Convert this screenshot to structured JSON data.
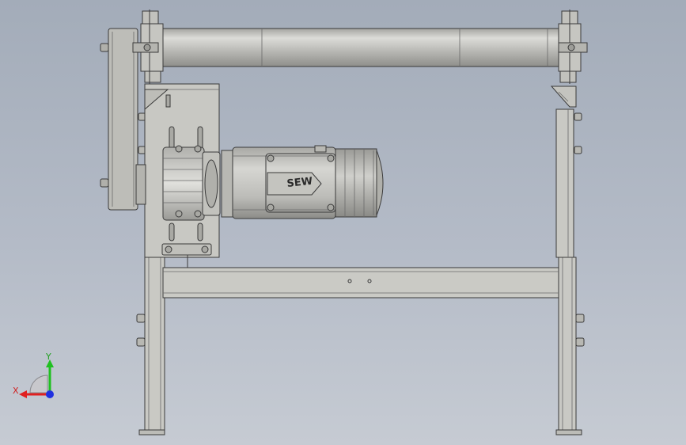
{
  "model": {
    "motor_brand_label": "SEW"
  },
  "triad": {
    "x_label": "X",
    "y_label": "Y",
    "x_color": "#e02020",
    "y_color": "#20c020",
    "z_color": "#2030e0"
  },
  "colors": {
    "background_top": "#a3acb9",
    "background_bottom": "#c6cbd3",
    "part_fill": "#c9c9c4",
    "part_shade": "#9e9e99",
    "edge": "#3a3a3a"
  }
}
